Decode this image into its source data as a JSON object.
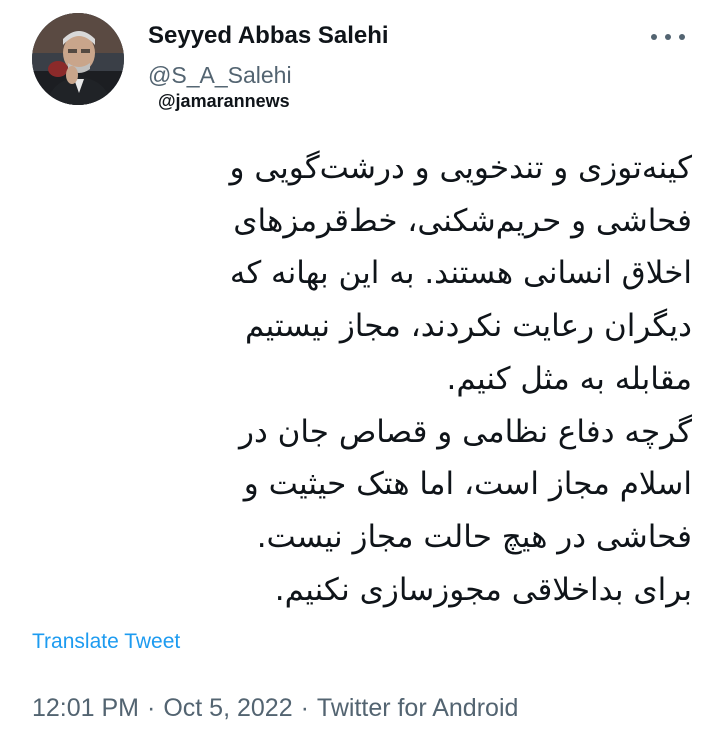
{
  "author": {
    "display_name": "Seyyed Abbas Salehi",
    "handle": "@S_A_Salehi"
  },
  "watermark": "@jamarannews",
  "more_icon": "more-horizontal-icon",
  "tweet": {
    "text": "کینه‌توزی و تندخویی و درشت‌گویی و\nفحاشی و حریم‌شکنی، خط‌قرمزهای\nاخلاق انسانی هستند. به این بهانه که\nدیگران رعایت نکردند، مجاز نیستیم\nمقابله به مثل کنیم.\n گرچه دفاع نظامی و قصاص جان در\nاسلام مجاز است، اما هتک حیثیت و\nفحاشی در هیچ حالت مجاز نیست.\nبرای بداخلاقی مجوزسازی نکنیم."
  },
  "translate_label": "Translate Tweet",
  "meta": {
    "time": "12:01 PM",
    "date": "Oct 5, 2022",
    "separator": "·",
    "source": "Twitter for Android"
  },
  "colors": {
    "link": "#1d9bf0",
    "secondary_text": "#536471",
    "primary_text": "#0f1419"
  }
}
